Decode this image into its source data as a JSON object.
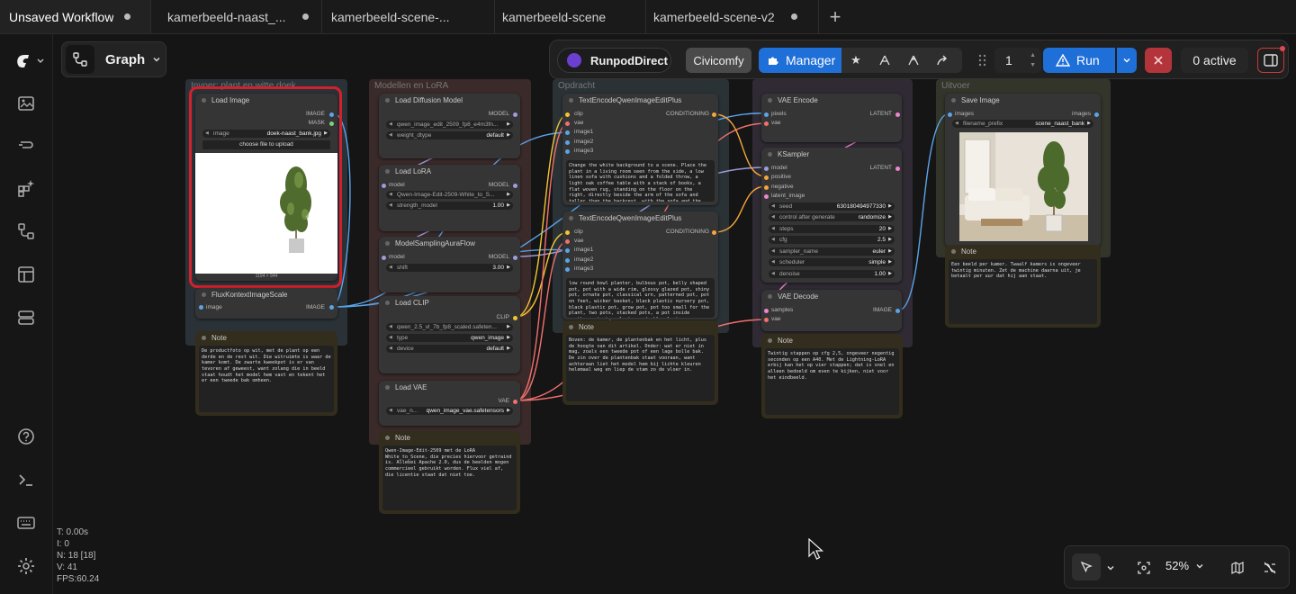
{
  "tabs": [
    {
      "label": "Unsaved Workflow",
      "dirty": true
    },
    {
      "label": "kamerbeeld-naast_...",
      "dirty": true
    },
    {
      "label": "kamerbeeld-scene-...",
      "dirty": false
    },
    {
      "label": "kamerbeeld-scene",
      "dirty": false
    },
    {
      "label": "kamerbeeld-scene-v2",
      "dirty": true
    }
  ],
  "new_tab_label": "+",
  "graph_button": {
    "label": "Graph"
  },
  "topbar": {
    "runpod": "RunpodDirect",
    "civicomfy": "Civicomfy",
    "manager": "Manager",
    "queue_count": "1",
    "run": "Run",
    "active": "0 active"
  },
  "groups": {
    "g1": "Invoer: plant en witte doek",
    "g2": "Modellen en LoRA",
    "g3": "Opdracht",
    "g4": "",
    "g5": "Uitvoer"
  },
  "nodes": {
    "load_image": {
      "title": "Load Image",
      "out1": "IMAGE",
      "out2": "MASK",
      "w_label": "image",
      "w_value": "doek-naast_bank.jpg",
      "upload": "choose file to upload",
      "dims": "1104 × 944"
    },
    "flux": {
      "title": "FluxKontextImageScale",
      "in1": "image",
      "out1": "IMAGE"
    },
    "note1": {
      "title": "Note",
      "text": "De productfoto op wit, met de plant op een derde en de rest wit. Die witruimte is waar de kamer komt. De zwarte kweekpot is er van tevoren af geweest, want zolang die in beeld staat houdt het model hem vast en tekent het er een tweede bak omheen."
    },
    "load_diff": {
      "title": "Load Diffusion Model",
      "out1": "MODEL",
      "w1_label": "",
      "w1_value": "qwen_image_edit_2509_fp8_e4m3fn...",
      "w2_label": "weight_dtype",
      "w2_value": "default"
    },
    "load_lora": {
      "title": "Load LoRA",
      "in1": "model",
      "out1": "MODEL",
      "w1_value": "Qwen-Image-Edit-2509-White_to_S...",
      "w2_label": "strength_model",
      "w2_value": "1.00"
    },
    "msaf": {
      "title": "ModelSamplingAuraFlow",
      "in1": "model",
      "out1": "MODEL",
      "w1_label": "shift",
      "w1_value": "3.00"
    },
    "load_clip": {
      "title": "Load CLIP",
      "out1": "CLIP",
      "w1_value": "qwen_2.5_vl_7b_fp8_scaled.safeten...",
      "w2_label": "type",
      "w2_value": "qwen_image",
      "w3_label": "device",
      "w3_value": "default"
    },
    "load_vae": {
      "title": "Load VAE",
      "out1": "VAE",
      "w1_label": "vae_n...",
      "w1_value": "qwen_image_vae.safetensors"
    },
    "note2": {
      "title": "Note",
      "text": "Qwen-Image-Edit-2509 met de LoRA White_to_Scene, die precies hiervoor getraind is. Allebei Apache 2.0, dus de beelden mogen commercieel gebruikt worden. Flux viel af, die licentie staat dat niet toe."
    },
    "te1": {
      "title": "TextEncodeQwenImageEditPlus",
      "in1": "clip",
      "in2": "vae",
      "in3": "image1",
      "in4": "image2",
      "in5": "image3",
      "out1": "CONDITIONING",
      "text": "Change the white background to a scene. Place the plant in a living room seen from the side, a low linen sofa with cushions and a folded throw, a light oak coffee table with a stack of books, a flat woven rug, standing on the floor on the right, directly beside the arm of the sofa and taller than the backrest, with the sofa and the"
    },
    "te2": {
      "title": "TextEncodeQwenImageEditPlus",
      "in1": "clip",
      "in2": "vae",
      "in3": "image1",
      "in4": "image2",
      "in5": "image3",
      "out1": "CONDITIONING",
      "text": "low round bowl planter, bulbous pot, belly shaped pot, pot with a wide rim, glossy glazed pot, shiny pot, ornate pot, classical urn, patterned pot, pot on feet, wicker basket, black plastic nursery pot, black plastic pot, grow pot, pot too small for the plant, two pots, stacked pots, a pot inside another pot, two planters, double planter, saucer"
    },
    "note3": {
      "title": "Note",
      "text": "Boven: de kamer, de plantenbak en het licht, plus de hoogte van dit artikel. Onder: wat er niet in mag, zoals een tweede pot of een lage bolle bak. De zin over de plantenbak staat vooraan, want achteraan liet het model hem bij lichte kleuren helemaal weg en liep de stam zo de vloer in."
    },
    "vae_enc": {
      "title": "VAE Encode",
      "in1": "pixels",
      "in2": "vae",
      "out1": "LATENT"
    },
    "ksampler": {
      "title": "KSampler",
      "in1": "model",
      "in2": "positive",
      "in3": "negative",
      "in4": "latent_image",
      "out1": "LATENT",
      "widgets": [
        {
          "label": "seed",
          "value": "630180494977330"
        },
        {
          "label": "control after generate",
          "value": "randomize"
        },
        {
          "label": "steps",
          "value": "20"
        },
        {
          "label": "cfg",
          "value": "2.5"
        },
        {
          "label": "sampler_name",
          "value": "euler"
        },
        {
          "label": "scheduler",
          "value": "simple"
        },
        {
          "label": "denoise",
          "value": "1.00"
        }
      ]
    },
    "vae_dec": {
      "title": "VAE Decode",
      "in1": "samples",
      "in2": "vae",
      "out1": "IMAGE"
    },
    "note4": {
      "title": "Note",
      "text": "Twintig stappen op cfg 2,5, ongeveer negentig seconden op een A40. Met de Lightning-LoRA erbij kan het op vier stappen; dat is snel en alleen bedoeld om even te kijken, niet voor het eindbeeld."
    },
    "save": {
      "title": "Save Image",
      "in1": "images",
      "out1": "images",
      "w1_label": "filename_prefix",
      "w1_value": "scene_naast_bank"
    },
    "note5": {
      "title": "Note",
      "text": "Een beeld per kamer. Twaalf kamers is ongeveer twintig minuten. Zet de machine daarna uit, je betaalt per uur dat hij aan staat."
    }
  },
  "stats": {
    "t": "T: 0.00s",
    "i": "I: 0",
    "n": "N: 18 [18]",
    "v": "V: 41",
    "fps": "FPS:60.24"
  },
  "zoom": {
    "value": "52%"
  },
  "colors": {
    "accent": "#1f6fd8",
    "highlight": "#d4202a",
    "note_border": "#6b5a2e",
    "wire_clip": "#f3c531",
    "wire_vae": "#f2706e",
    "wire_model": "#9f9cdc",
    "wire_image": "#5ba4e8",
    "wire_cond": "#f6a63c",
    "wire_latent": "#f084d2"
  }
}
